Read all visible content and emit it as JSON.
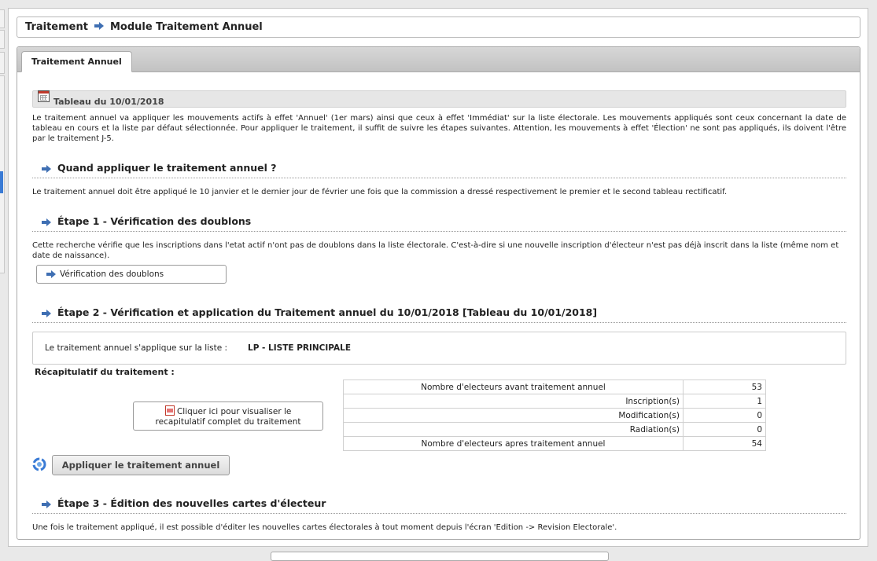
{
  "breadcrumb": {
    "part1": "Traitement",
    "part2": "Module Traitement Annuel"
  },
  "tab": {
    "label": "Traitement Annuel"
  },
  "tableau_bar": {
    "label": "Tableau du 10/01/2018"
  },
  "intro": {
    "text": "Le traitement annuel va appliquer les mouvements actifs à effet 'Annuel' (1er mars) ainsi que ceux à effet 'Immédiat' sur la liste électorale. Les mouvements appliqués sont ceux concernant la date de tableau en cours et la liste par défaut sélectionnée. Pour appliquer le traitement, il suffit de suivre les étapes suivantes. Attention, les mouvements à effet 'Élection' ne sont pas appliqués, ils doivent l'être par le traitement J-5."
  },
  "section_quand": {
    "title": "Quand appliquer le traitement annuel ?",
    "text": "Le traitement annuel doit être appliqué le 10 janvier et le dernier jour de février une fois que la commission a dressé respectivement le premier et le second tableau rectificatif."
  },
  "section_etape1": {
    "title": "Étape 1 - Vérification des doublons",
    "text": "Cette recherche vérifie que les inscriptions dans l'etat actif n'ont pas de doublons dans la liste électorale. C'est-à-dire si une nouvelle inscription d'électeur n'est pas déjà inscrit dans la liste (même nom et date de naissance).",
    "button": "Vérification des doublons"
  },
  "section_etape2": {
    "title": "Étape 2 - Vérification et application du Traitement annuel du 10/01/2018 [Tableau du 10/01/2018]",
    "list_prefix": "Le traitement annuel s'applique sur la liste :",
    "list_value": "LP - LISTE PRINCIPALE",
    "recap_label": "Récapitulatif du traitement :",
    "view_button_line1": "Cliquer ici pour visualiser le",
    "view_button_line2": "recapitulatif complet du traitement",
    "table": [
      {
        "label": "Nombre d'electeurs avant traitement annuel",
        "value": "53"
      },
      {
        "label": "Inscription(s)",
        "value": "1"
      },
      {
        "label": "Modification(s)",
        "value": "0"
      },
      {
        "label": "Radiation(s)",
        "value": "0"
      },
      {
        "label": "Nombre d'electeurs apres traitement annuel",
        "value": "54"
      }
    ],
    "apply_button": "Appliquer le traitement annuel"
  },
  "section_etape3": {
    "title": "Étape 3 - Édition des nouvelles cartes d'électeur",
    "text": "Une fois le traitement appliqué, il est possible d'éditer les nouvelles cartes électorales à tout moment depuis l'écran 'Edition -> Revision Electorale'."
  },
  "colors": {
    "arrow": "#3f6fb3",
    "accent": "#3a7bd5"
  }
}
